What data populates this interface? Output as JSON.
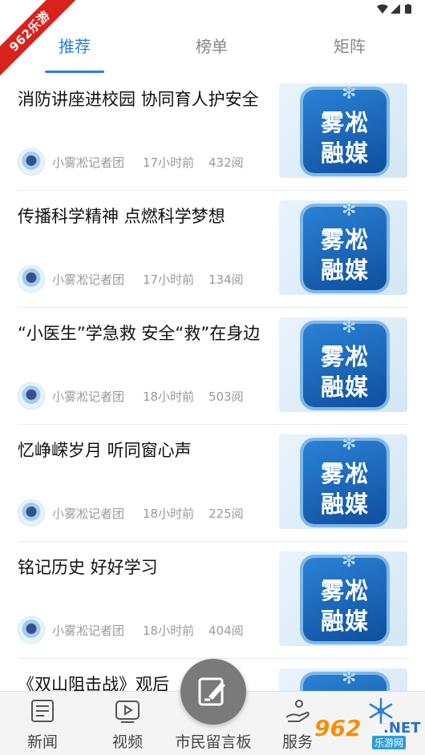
{
  "ribbon": "962乐游",
  "tabs": [
    {
      "label": "推荐",
      "active": true
    },
    {
      "label": "榜单",
      "active": false
    },
    {
      "label": "矩阵",
      "active": false
    }
  ],
  "thumb": {
    "line1": "雾凇",
    "line2": "融媒"
  },
  "feed": [
    {
      "title": "消防讲座进校园 协同育人护安全",
      "author": "小雾凇记者团",
      "time": "17小时前",
      "views": "432阅"
    },
    {
      "title": "传播科学精神 点燃科学梦想",
      "author": "小雾凇记者团",
      "time": "17小时前",
      "views": "134阅"
    },
    {
      "title": "“小医生”学急救 安全“救”在身边",
      "author": "小雾凇记者团",
      "time": "18小时前",
      "views": "503阅"
    },
    {
      "title": "忆峥嵘岁月 听同窗心声",
      "author": "小雾凇记者团",
      "time": "18小时前",
      "views": "225阅"
    },
    {
      "title": "铭记历史 好好学习",
      "author": "小雾凇记者团",
      "time": "18小时前",
      "views": "404阅"
    },
    {
      "title": "《双山阻击战》观后",
      "author": "",
      "time": "",
      "views": ""
    }
  ],
  "nav": [
    {
      "label": "新闻",
      "icon": "news-icon"
    },
    {
      "label": "视频",
      "icon": "video-icon"
    },
    {
      "label": "市民留言板",
      "icon": "edit-icon"
    },
    {
      "label": "服务",
      "icon": "service-icon"
    },
    {
      "label": "",
      "icon": "snowflake-icon"
    }
  ],
  "watermark": {
    "num": "962",
    "net": ".NET",
    "sub": "乐游网"
  },
  "colors": {
    "accent": "#2a7fe0",
    "ribbon": "#d9221c",
    "tile": "#1e6cc0"
  }
}
